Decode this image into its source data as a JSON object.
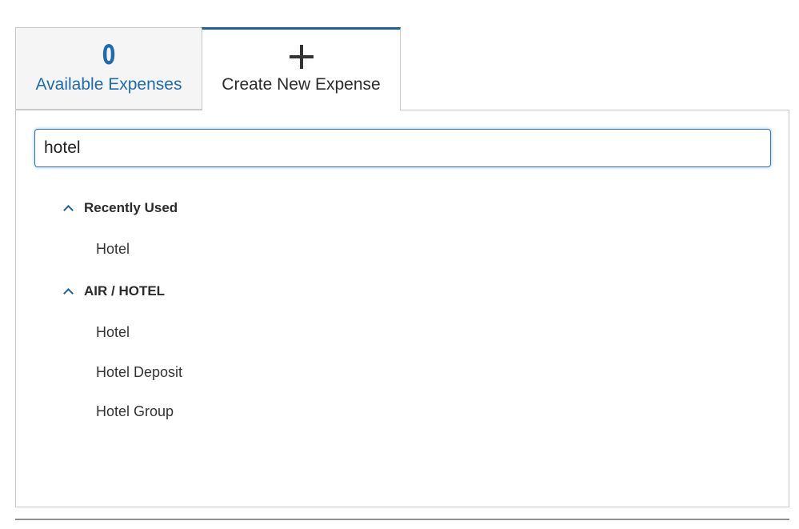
{
  "tabs": {
    "available": {
      "count": "0",
      "label": "Available Expenses"
    },
    "create": {
      "icon": "plus-icon",
      "label": "Create New Expense"
    }
  },
  "search": {
    "value": "hotel"
  },
  "groups": [
    {
      "label": "Recently Used",
      "icon": "chevron-up-icon",
      "items": [
        "Hotel"
      ]
    },
    {
      "label": "AIR / HOTEL",
      "icon": "chevron-up-icon",
      "items": [
        "Hotel",
        "Hotel Deposit",
        "Hotel Group"
      ]
    }
  ],
  "colors": {
    "accent": "#1e6bb0",
    "tab_active_border": "#1e5f9e",
    "border": "#c9c9c9"
  }
}
